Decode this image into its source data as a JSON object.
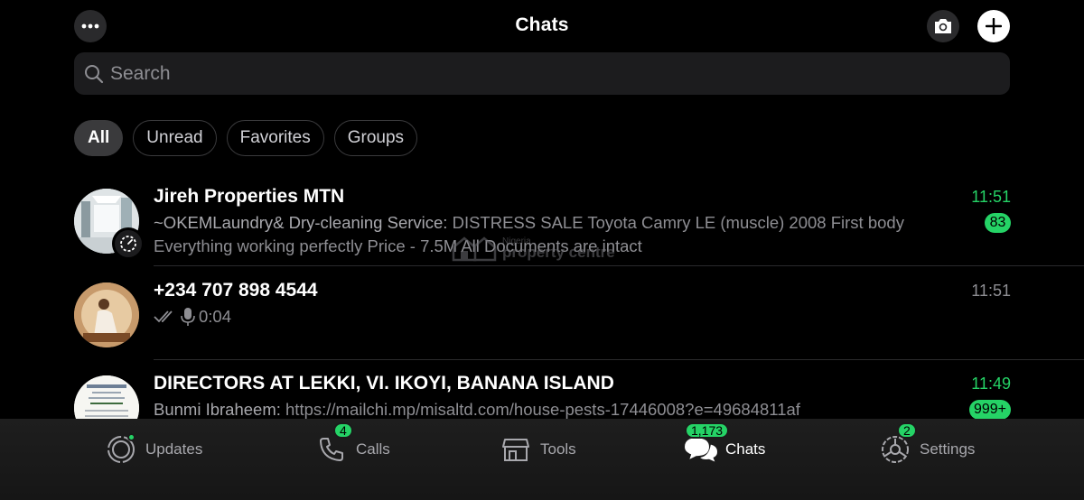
{
  "header": {
    "title": "Chats",
    "menu_icon": "ellipsis-icon",
    "camera_icon": "camera-icon",
    "add_icon": "plus-icon"
  },
  "search": {
    "placeholder": "Search"
  },
  "filters": [
    "All",
    "Unread",
    "Favorites",
    "Groups"
  ],
  "chats": [
    {
      "name": "Jireh Properties MTN",
      "time": "11:51",
      "sender": "~OKEMLaundry& Dry-cleaning Service:",
      "message": " DISTRESS SALE  Toyota Camry LE (muscle) 2008 First body Everything working perfectly  Price - 7.5M All Documents are intact",
      "unread": "83"
    },
    {
      "name": "+234 707 898 4544",
      "time": "11:51",
      "message": "0:04"
    },
    {
      "name": "DIRECTORS AT LEKKI, VI. IKOYI, BANANA ISLAND",
      "time": "11:49",
      "sender": "Bunmi Ibraheem:",
      "message": " https://mailchi.mp/misaltd.com/house-pests-17446008?e=49684811af",
      "unread": "999+"
    }
  ],
  "watermark": {
    "top": "Nigeria",
    "bottom": "property centre"
  },
  "tabs": [
    {
      "label": "Updates",
      "icon": "updates-icon",
      "badge": ""
    },
    {
      "label": "Calls",
      "icon": "phone-icon",
      "badge": "4"
    },
    {
      "label": "Tools",
      "icon": "storefront-icon",
      "badge": ""
    },
    {
      "label": "Chats",
      "icon": "chat-bubbles-icon",
      "badge": "1,173"
    },
    {
      "label": "Settings",
      "icon": "gear-icon",
      "badge": "2"
    }
  ],
  "colors": {
    "accent": "#25d366",
    "background": "#000000",
    "muted": "#8e8e93"
  }
}
